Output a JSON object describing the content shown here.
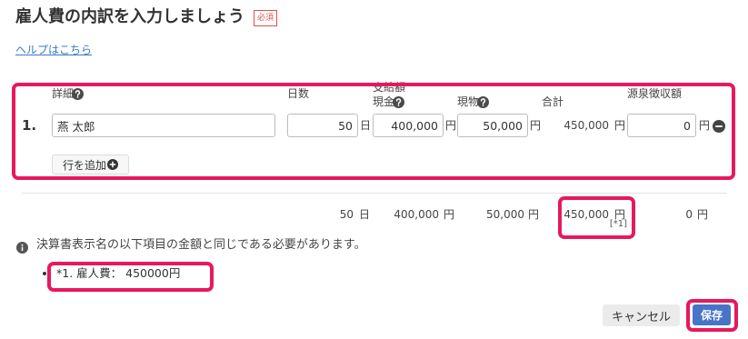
{
  "dialog": {
    "title": "雇人費の内訳を入力しましょう",
    "required_badge": "必須",
    "help_link": "ヘルプはこちら"
  },
  "table": {
    "headers": {
      "detail": "詳細",
      "days": "日数",
      "payment": "支給額",
      "cash": "現金",
      "in_kind": "現物",
      "total": "合計",
      "withholding": "源泉徴収額"
    },
    "rows": [
      {
        "number": "1.",
        "name": "燕 太郎",
        "days": "50",
        "days_unit": "日",
        "cash": "400,000",
        "cash_unit": "円",
        "in_kind": "50,000",
        "in_kind_unit": "円",
        "total": "450,000",
        "total_unit": "円",
        "withholding": "0",
        "withholding_unit": "円"
      }
    ],
    "add_row_label": "行を追加"
  },
  "totals": {
    "days": "50",
    "days_unit": "日",
    "cash": "400,000",
    "cash_unit": "円",
    "in_kind": "50,000",
    "in_kind_unit": "円",
    "total": "450,000",
    "total_unit": "円",
    "total_ref": "[*1]",
    "withholding": "0",
    "withholding_unit": "円"
  },
  "notice": {
    "text": "決算書表示名の以下項目の金額と同じである必要があります。",
    "items": [
      "*1. 雇人費： 450000円"
    ]
  },
  "actions": {
    "cancel_label": "キャンセル",
    "save_label": "保存"
  },
  "icons": {
    "help": "question-circle-icon",
    "remove_row": "minus-circle-icon",
    "add_row": "plus-circle-icon",
    "info": "info-circle-icon"
  },
  "colors": {
    "accent_highlight": "#e8185e",
    "required": "#e05050",
    "link": "#3a78c3",
    "primary": "#4775c6",
    "secondary_button": "#ebebeb"
  }
}
